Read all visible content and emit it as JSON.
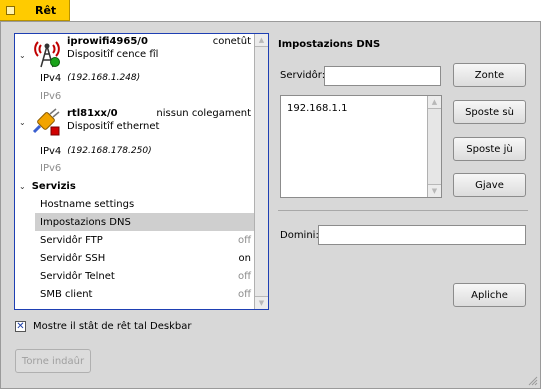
{
  "window": {
    "tab_title": "Rêt"
  },
  "list": {
    "devices": [
      {
        "name": "iprowifi4965/0",
        "status": "conetût",
        "type": "Dispositîf cence fîl",
        "ipv4_label": "IPv4",
        "ipv4_value": "(192.168.1.248)",
        "ipv6_label": "IPv6"
      },
      {
        "name": "rtl81xx/0",
        "status": "nissun colegament",
        "type": "Dispositîf ethernet",
        "ipv4_label": "IPv4",
        "ipv4_value": "(192.168.178.250)",
        "ipv6_label": "IPv6"
      }
    ],
    "services_header": "Servizis",
    "services": [
      {
        "label": "Hostname settings",
        "state": ""
      },
      {
        "label": "Impostazions DNS",
        "state": ""
      },
      {
        "label": "Servidôr FTP",
        "state": "off"
      },
      {
        "label": "Servidôr SSH",
        "state": "on"
      },
      {
        "label": "Servidôr Telnet",
        "state": "off"
      },
      {
        "label": "SMB client",
        "state": "off"
      }
    ]
  },
  "dns": {
    "title": "Impostazions DNS",
    "server_label": "Servidôr:",
    "server_value": "",
    "add_button": "Zonte",
    "servers": [
      "192.168.1.1"
    ],
    "move_up_button": "Sposte sù",
    "move_down_button": "Sposte jù",
    "remove_button": "Gjave",
    "domain_label": "Domini:",
    "domain_value": "",
    "apply_button": "Apliche"
  },
  "footer": {
    "deskbar_checkbox_label": "Mostre il stât de rêt tal Deskbar",
    "deskbar_checked": true,
    "revert_button": "Torne indaûr"
  }
}
